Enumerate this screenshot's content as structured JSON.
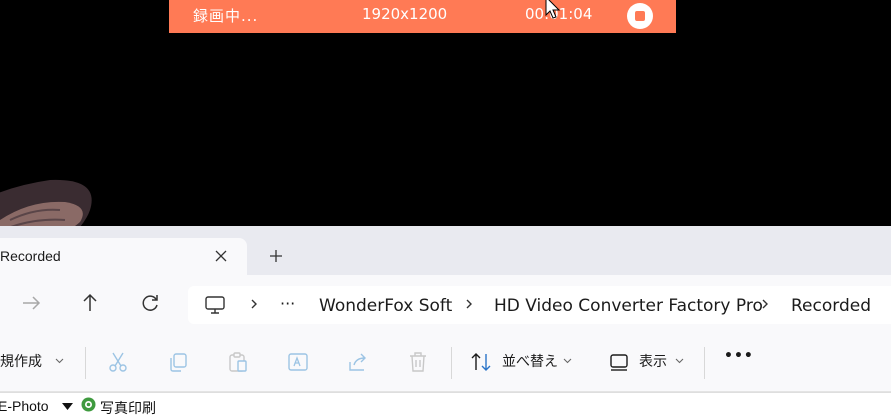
{
  "recorder": {
    "status": "録画中...",
    "resolution": "1920x1200",
    "elapsed": "00:01:04",
    "stop_icon": "stop-icon",
    "accent": "#ff7a55"
  },
  "explorer": {
    "tab": {
      "label": "Recorded",
      "close_icon": "close-icon"
    },
    "new_tab_icon": "plus-icon",
    "nav": {
      "back_icon": "arrow-left-icon",
      "forward_icon": "arrow-right-icon",
      "up_icon": "arrow-up-icon",
      "refresh_icon": "refresh-icon"
    },
    "breadcrumb": {
      "root_icon": "monitor-icon",
      "overflow": "···",
      "items": [
        "WonderFox Soft",
        "HD Video Converter Factory Pro",
        "Recorded"
      ]
    },
    "toolbar": {
      "new_label": "新規作成",
      "sort_label": "並べ替え",
      "view_label": "表示",
      "more_label": "•••",
      "icons": [
        "cut-icon",
        "copy-icon",
        "paste-icon",
        "rename-icon",
        "share-icon",
        "delete-icon"
      ]
    },
    "status_line": {
      "left": "E-Photo",
      "print_label": "写真印刷"
    }
  }
}
